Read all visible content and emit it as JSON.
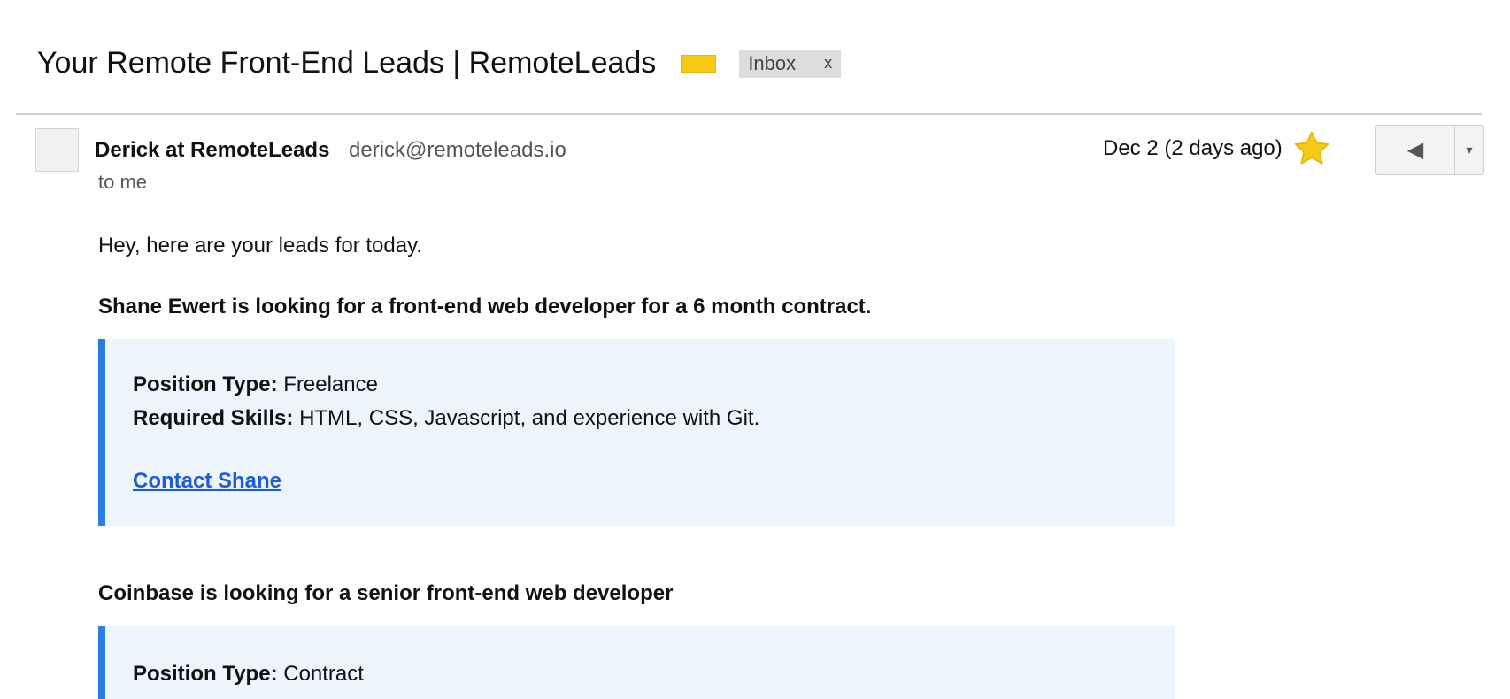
{
  "email": {
    "subject": "Your Remote Front-End Leads | RemoteLeads",
    "label_color": "#f6c915",
    "inbox_chip": {
      "label": "Inbox",
      "close": "x"
    }
  },
  "message": {
    "sender_name": "Derick at RemoteLeads",
    "sender_email": "derick@remoteleads.io",
    "recipient": "to me",
    "date": "Dec 2 (2 days ago)",
    "starred": true,
    "star_color": "#f6c915",
    "reply_icon": "◀",
    "more_icon": "▾",
    "greeting": "Hey, here are your leads for today.",
    "leads": [
      {
        "heading": "Shane Ewert is looking for a front-end web developer for a 6 month contract.",
        "position_type_label": "Position Type:",
        "position_type": "Freelance",
        "skills_label": "Required Skills:",
        "skills": "HTML, CSS, Javascript, and experience with Git.",
        "contact": "Contact Shane"
      },
      {
        "heading": "Coinbase is looking for a senior front-end web developer",
        "position_type_label": "Position Type:",
        "position_type": "Contract"
      }
    ],
    "accent_color": "#2a7fde",
    "card_background": "#edf4fc"
  }
}
